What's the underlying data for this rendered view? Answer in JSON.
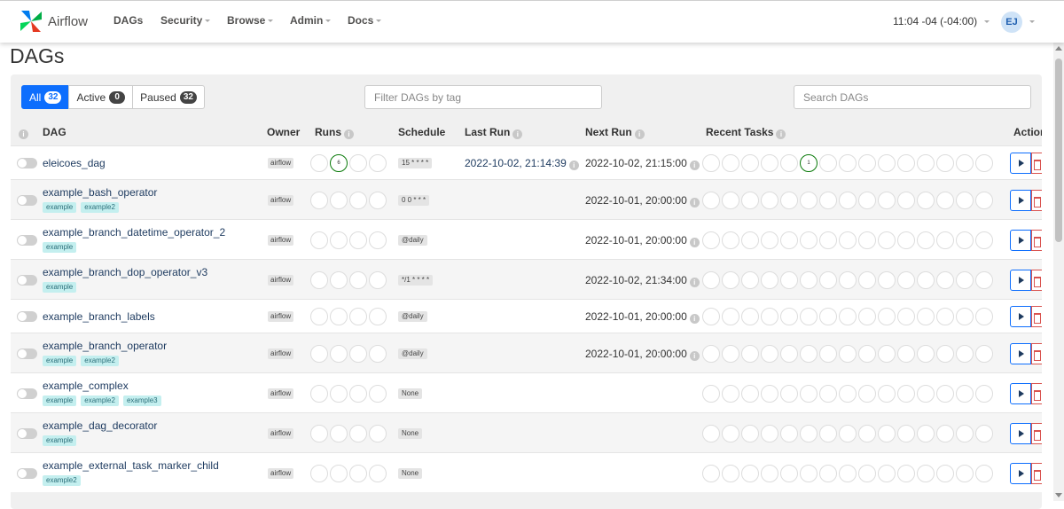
{
  "navbar": {
    "brand": "Airflow",
    "links": [
      "DAGs",
      "Security",
      "Browse",
      "Admin",
      "Docs"
    ],
    "clock": "11:04 -04 (-04:00)",
    "user_initials": "EJ",
    "logo_colors": [
      "#017cee",
      "#00ad46",
      "#e43921",
      "#04d659"
    ]
  },
  "page": {
    "title": "DAGs"
  },
  "filters": {
    "all_label": "All",
    "all_count": "32",
    "active_label": "Active",
    "active_count": "0",
    "paused_label": "Paused",
    "paused_count": "32",
    "tag_placeholder": "Filter DAGs by tag",
    "search_placeholder": "Search DAGs"
  },
  "table": {
    "headers": {
      "info": "i",
      "dag": "DAG",
      "owner": "Owner",
      "runs": "Runs",
      "schedule": "Schedule",
      "last_run": "Last Run",
      "next_run": "Next Run",
      "recent_tasks": "Recent Tasks",
      "actions": "Actions"
    },
    "rows": [
      {
        "name": "eleicoes_dag",
        "tags": [],
        "owner": "airflow",
        "runs_count": "6",
        "schedule": "15 * * * *",
        "last_run": "2022-10-02, 21:14:39",
        "next_run": "2022-10-02, 21:15:00",
        "tasks_count": "1"
      },
      {
        "name": "example_bash_operator",
        "tags": [
          "example",
          "example2"
        ],
        "owner": "airflow",
        "runs_count": "",
        "schedule": "0 0 * * *",
        "last_run": "",
        "next_run": "2022-10-01, 20:00:00",
        "tasks_count": ""
      },
      {
        "name": "example_branch_datetime_operator_2",
        "tags": [
          "example"
        ],
        "owner": "airflow",
        "runs_count": "",
        "schedule": "@daily",
        "last_run": "",
        "next_run": "2022-10-01, 20:00:00",
        "tasks_count": ""
      },
      {
        "name": "example_branch_dop_operator_v3",
        "tags": [
          "example"
        ],
        "owner": "airflow",
        "runs_count": "",
        "schedule": "*/1 * * * *",
        "last_run": "",
        "next_run": "2022-10-02, 21:34:00",
        "tasks_count": ""
      },
      {
        "name": "example_branch_labels",
        "tags": [],
        "owner": "airflow",
        "runs_count": "",
        "schedule": "@daily",
        "last_run": "",
        "next_run": "2022-10-01, 20:00:00",
        "tasks_count": ""
      },
      {
        "name": "example_branch_operator",
        "tags": [
          "example",
          "example2"
        ],
        "owner": "airflow",
        "runs_count": "",
        "schedule": "@daily",
        "last_run": "",
        "next_run": "2022-10-01, 20:00:00",
        "tasks_count": ""
      },
      {
        "name": "example_complex",
        "tags": [
          "example",
          "example2",
          "example3"
        ],
        "owner": "airflow",
        "runs_count": "",
        "schedule": "None",
        "last_run": "",
        "next_run": "",
        "tasks_count": ""
      },
      {
        "name": "example_dag_decorator",
        "tags": [
          "example"
        ],
        "owner": "airflow",
        "runs_count": "",
        "schedule": "None",
        "last_run": "",
        "next_run": "",
        "tasks_count": ""
      },
      {
        "name": "example_external_task_marker_child",
        "tags": [
          "example2"
        ],
        "owner": "airflow",
        "runs_count": "",
        "schedule": "None",
        "last_run": "",
        "next_run": "",
        "tasks_count": ""
      }
    ]
  },
  "colors": {
    "accent": "#0d6efd",
    "success": "#0a7a0a",
    "danger": "#d9534f",
    "dag_link": "#1d3a5f",
    "tag_bg": "#c4efef"
  }
}
